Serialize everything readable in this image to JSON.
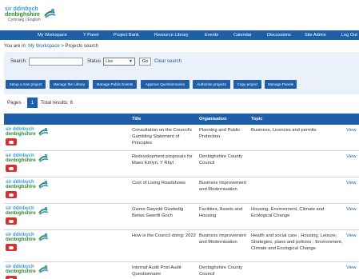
{
  "logo": {
    "line1": "sir ddinbych",
    "line2": "denbighshire",
    "lang": "Cymraeg | English"
  },
  "nav": {
    "items": [
      "My Workspace",
      "Y Panel",
      "Project Bank",
      "Resource Library",
      "Events",
      "Calendar",
      "Discussions",
      "Site Admin",
      "Log Out"
    ]
  },
  "breadcrumb": {
    "prefix": "You are in:",
    "link": "My Workspace",
    "current": "> Projects search"
  },
  "search": {
    "label": "Search:",
    "value": "",
    "placeholder": "",
    "status_label": "Status",
    "status_value": "Live",
    "go_label": "Go",
    "clear_label": "Clear search"
  },
  "actions": [
    "Setup a new project",
    "Manage the Library",
    "Manage Public Events",
    "Approve Questionnaires",
    "Authorise projects",
    "Copy project",
    "Manage Panel▾"
  ],
  "pager": {
    "pages_label": "Pages",
    "current_page": "1",
    "total": "Total results: 8"
  },
  "table": {
    "headers": [
      "",
      "Title",
      "Organisation",
      "Topic",
      ""
    ],
    "rows": [
      {
        "title": "Consultation on the Council's Gambling Statement of Principles",
        "organisation": "Planning and Public Protection",
        "topic": "Business, Licences and permits",
        "action": "View"
      },
      {
        "title": "Redevelopment proposals for Maes Emlyn, Y Rhyl",
        "organisation": "Denbighshire County Council",
        "topic": "",
        "action": "View"
      },
      {
        "title": "Cost of Living Roadshows",
        "organisation": "Business Improvement and Modernisation",
        "topic": "",
        "action": "View"
      },
      {
        "title": "Gwres Gwyrdd Gweledig Betws Gwerfil Goch",
        "organisation": "Facilities, Assets and Housing",
        "topic": "Housing, Environment, Climate and Ecological Change",
        "action": "View"
      },
      {
        "title": "How is the Council doing: 2022",
        "organisation": "Business Improvement and Modernisation",
        "topic": "Health and social care , Housing, Leisure, Strategies, plans and policies , Environment, Climate and Ecological Change",
        "action": "View"
      },
      {
        "title": "Internal Audit Post Audit Questionnaire",
        "organisation": "Denbighshire County Council",
        "topic": "",
        "action": "View"
      }
    ]
  },
  "colors": {
    "nav": "#1f5fa8",
    "panel": "#eaf1fa",
    "badge": "#d9302f"
  }
}
